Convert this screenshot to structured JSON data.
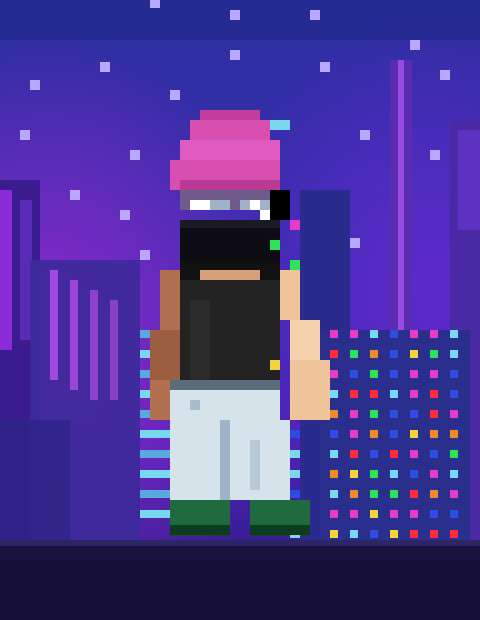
{
  "scene": {
    "description_icons": [
      "pixel-night-city-icon",
      "pixel-character-icon"
    ],
    "colors": {
      "sky_top": "#2e2d9a",
      "sky_mid": "#3b2bb0",
      "sky_bottom": "#6a22b5",
      "neon_pink": "#e23cc8",
      "neon_purple": "#7b2fd0",
      "window_cyan": "#79d7f0",
      "window_blue": "#2e4de0",
      "window_orange": "#f08a2a",
      "window_magenta": "#e83cc5",
      "window_green": "#2ee35a",
      "window_yellow": "#f4d23a",
      "window_red": "#ff2b3b",
      "ground_dark": "#1a1240",
      "beanie_pink": "#d94fb0",
      "skin": "#f0c49a",
      "tank_top": "#222222",
      "jeans": "#d6e3ea",
      "shoes": "#1f6a3e"
    }
  }
}
